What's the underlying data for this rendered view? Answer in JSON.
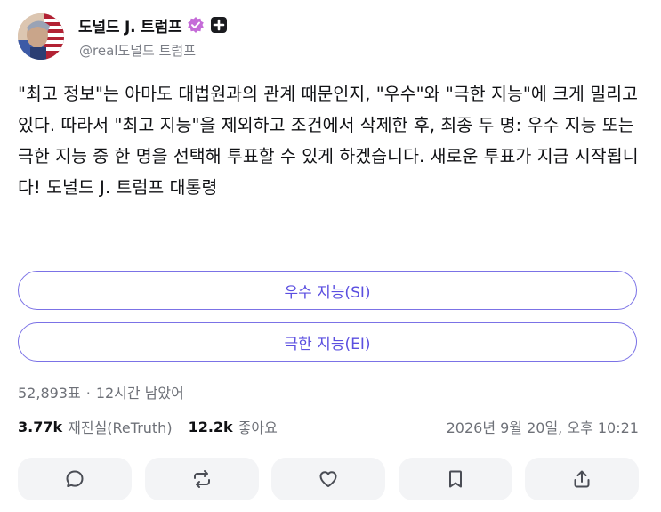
{
  "user": {
    "display_name": "도널드 J. 트럼프",
    "handle": "@real도널드 트럼프",
    "verified_icon": "verified-badge-icon",
    "plus_icon": "plus-badge-icon",
    "badge_color": "#c56cd8"
  },
  "post": {
    "text": "\"최고 정보\"는 아마도 대법원과의 관계 때문인지, \"우수\"와 \"극한 지능\"에 크게 밀리고 있다. 따라서 \"최고 지능\"을 제외하고 조건에서 삭제한 후, 최종 두 명: 우수 지능 또는 극한 지능 중 한 명을 선택해 투표할 수 있게 하겠습니다. 새로운 투표가 지금 시작됩니다! 도널드 J. 트럼프 대통령"
  },
  "poll": {
    "options": [
      {
        "label": "우수 지능(SI)"
      },
      {
        "label": "극한 지능(EI)"
      }
    ],
    "votes": "52,893표",
    "separator": "·",
    "time_left": "12시간 남았어",
    "accent_color": "#5b4fe0"
  },
  "stats": {
    "retruths_count": "3.77k",
    "retruths_label": "재진실(ReTruth)",
    "likes_count": "12.2k",
    "likes_label": "좋아요",
    "timestamp": "2026년 9월 20일, 오후 10:21"
  },
  "actions": [
    {
      "icon": "reply-icon"
    },
    {
      "icon": "retruth-icon"
    },
    {
      "icon": "like-icon"
    },
    {
      "icon": "bookmark-icon"
    },
    {
      "icon": "share-icon"
    }
  ]
}
